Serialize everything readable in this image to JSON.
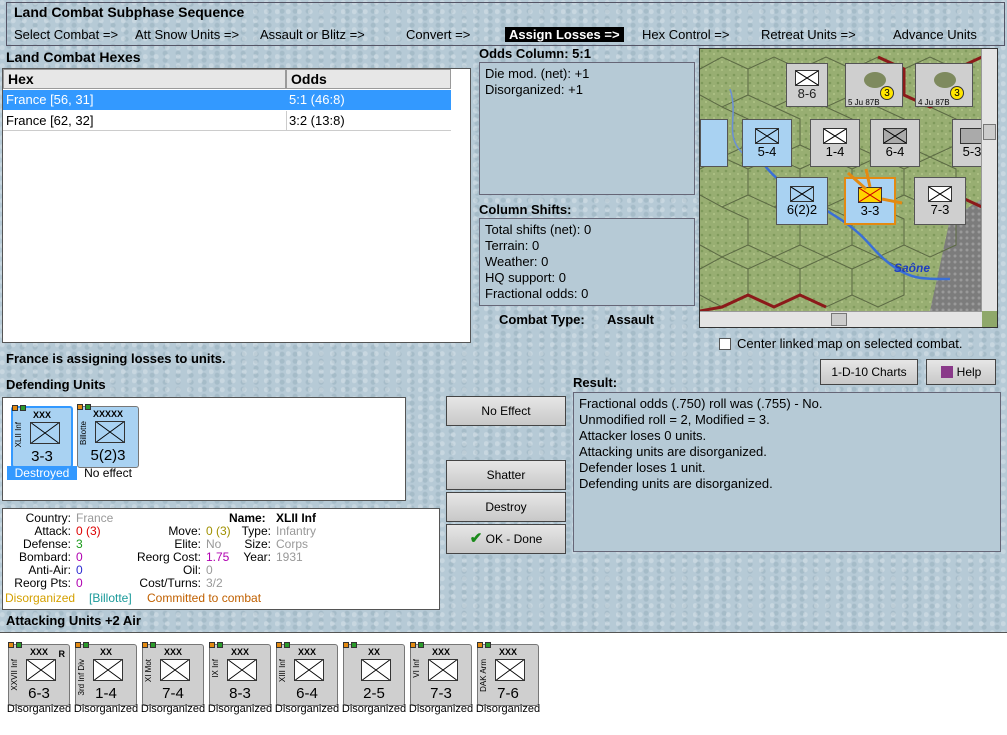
{
  "sequence": {
    "title": "Land Combat Subphase Sequence",
    "steps": [
      "Select Combat =>",
      "Att Snow Units =>",
      "Assault or Blitz =>",
      "Convert =>",
      "Assign Losses =>",
      "Hex Control =>",
      "Retreat Units =>",
      "Advance Units"
    ],
    "active_index": 4
  },
  "hexes": {
    "title": "Land Combat Hexes",
    "col_hex": "Hex",
    "col_odds": "Odds",
    "rows": [
      {
        "hex": "France [56, 31]",
        "odds": "5:1 (46:8)"
      },
      {
        "hex": "France [62, 32]",
        "odds": "3:2 (13:8)"
      }
    ],
    "selected_index": 0
  },
  "odds_column": {
    "title": "Odds Column: 5:1",
    "lines": [
      "Die mod. (net): +1",
      "Disorganized: +1"
    ]
  },
  "column_shifts": {
    "title": "Column Shifts:",
    "lines": [
      "Total shifts (net): 0",
      "Terrain: 0",
      "Weather: 0",
      "HQ support: 0",
      "Fractional odds: 0"
    ]
  },
  "combat_type": {
    "label": "Combat Type:",
    "value": "Assault"
  },
  "map": {
    "river_label": "Saône",
    "center_linked_label": "Center linked map on selected combat.",
    "counters": [
      "8-6",
      "3",
      "4 Ju 87B",
      "5 Ju 87B",
      "5-4",
      "1-4",
      "6-4",
      "5-3",
      "6(2)2",
      "3-3",
      "7-3",
      "3"
    ]
  },
  "status_line": "France is assigning losses to units.",
  "defending": {
    "title": "Defending Units",
    "units": [
      {
        "name": "XLII Inf",
        "size": "XXX",
        "value": "3-3",
        "status": "Destroyed"
      },
      {
        "name": "Billotte",
        "size": "XXXXX",
        "value": "5(2)3",
        "status": "No effect"
      }
    ]
  },
  "buttons": {
    "no_effect": "No Effect",
    "shatter": "Shatter",
    "destroy": "Destroy",
    "ok_done": "OK - Done",
    "charts": "1-D-10 Charts",
    "help": "Help"
  },
  "result": {
    "title": "Result:",
    "lines": [
      "Fractional odds (.750) roll was (.755)  - No.",
      "Unmodified roll = 2, Modified = 3.",
      "Attacker loses 0 units.",
      "Attacking units are disorganized.",
      "Defender loses 1 unit.",
      "Defending units are disorganized."
    ]
  },
  "details": {
    "country_label": "Country:",
    "country": "France",
    "attack_label": "Attack:",
    "attack": "0 (3)",
    "defense_label": "Defense:",
    "defense": "3",
    "bombard_label": "Bombard:",
    "bombard": "0",
    "antiair_label": "Anti-Air:",
    "antiair": "0",
    "reorgpts_label": "Reorg Pts:",
    "reorgpts": "0",
    "move_label": "Move:",
    "move": "0 (3)",
    "elite_label": "Elite:",
    "elite": "No",
    "reorgcost_label": "Reorg Cost:",
    "reorgcost": "1.75",
    "oil_label": "Oil:",
    "oil": "0",
    "costturns_label": "Cost/Turns:",
    "costturns": "3/2",
    "name_label": "Name:",
    "name": "XLII Inf",
    "type_label": "Type:",
    "type": "Infantry",
    "size_label": "Size:",
    "size": "Corps",
    "year_label": "Year:",
    "year": "1931",
    "flag1": "Disorganized",
    "flag2": "[Billotte]",
    "flag3": "Committed to combat"
  },
  "attacking": {
    "title": "Attacking Units +2 Air",
    "units": [
      {
        "name": "XXVII Inf",
        "size": "XXX",
        "value": "6-3",
        "status": "Disorganized",
        "r": "R"
      },
      {
        "name": "3rd Inf Div",
        "size": "XX",
        "value": "1-4",
        "status": "Disorganized",
        "r": ""
      },
      {
        "name": "XI Mot",
        "size": "XXX",
        "value": "7-4",
        "status": "Disorganized",
        "r": ""
      },
      {
        "name": "IX Inf",
        "size": "XXX",
        "value": "8-3",
        "status": "Disorganized",
        "r": ""
      },
      {
        "name": "XIII Inf",
        "size": "XXX",
        "value": "6-4",
        "status": "Disorganized",
        "r": ""
      },
      {
        "name": "",
        "size": "XX",
        "value": "2-5",
        "status": "Disorganized",
        "r": ""
      },
      {
        "name": "VI Inf",
        "size": "XXX",
        "value": "7-3",
        "status": "Disorganized",
        "r": ""
      },
      {
        "name": "DAK Arm",
        "size": "XXX",
        "value": "7-6",
        "status": "Disorganized",
        "r": ""
      }
    ]
  },
  "colors": {
    "selection": "#3399ff",
    "allied_counter": "#a9d2f2",
    "axis_counter": "#cfcfcf"
  }
}
